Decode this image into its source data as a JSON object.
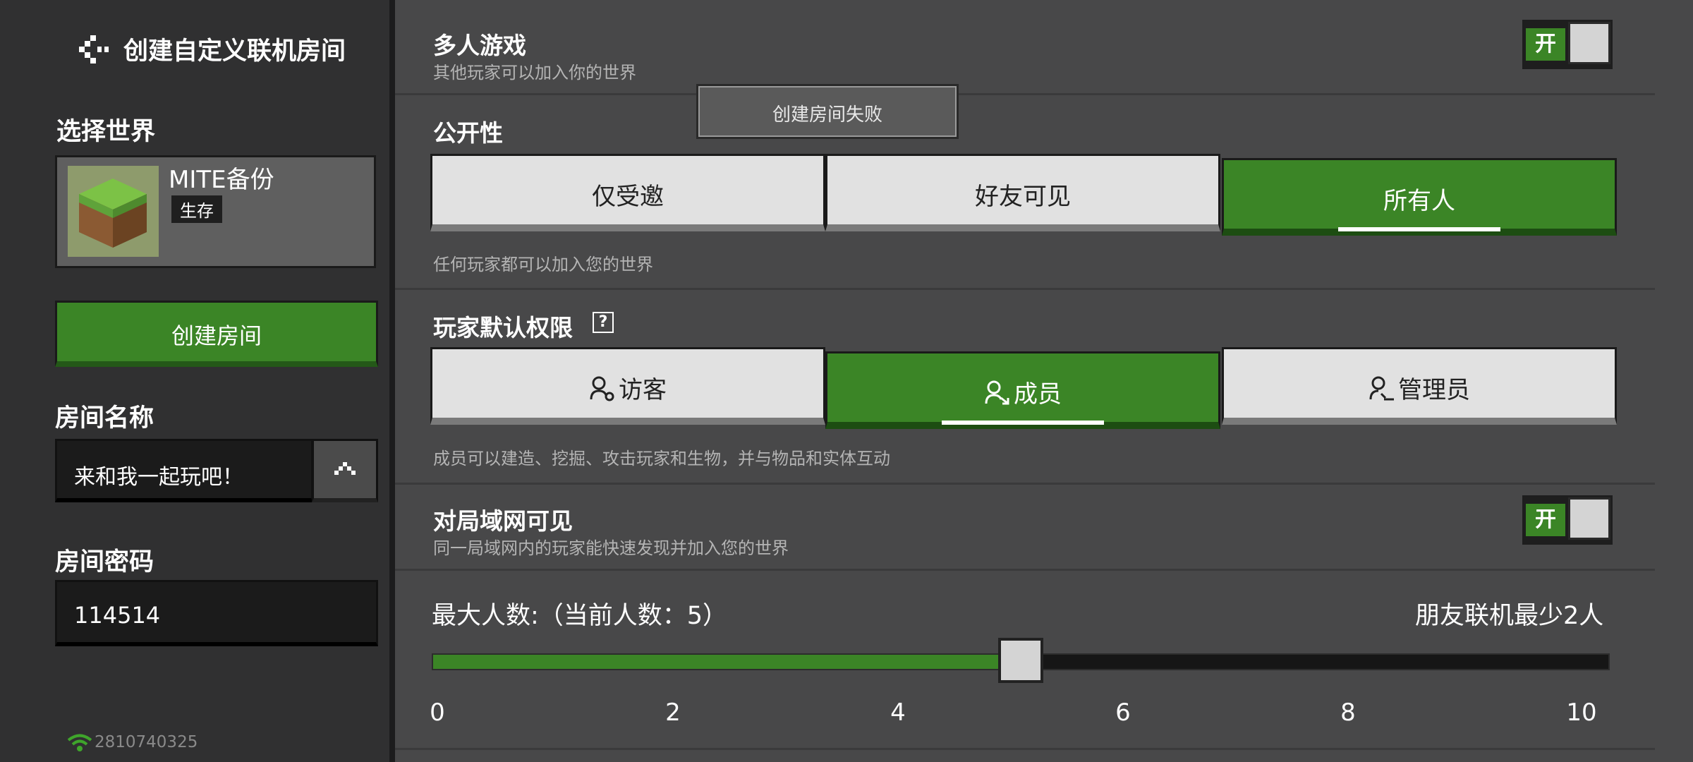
{
  "sidebar": {
    "title": "创建自定义联机房间",
    "select_world_label": "选择世界",
    "world": {
      "name": "MITE备份",
      "mode": "生存"
    },
    "create_button": "创建房间",
    "room_name_label": "房间名称",
    "room_name_value": "来和我一起玩吧！",
    "room_password_label": "房间密码",
    "room_password_value": "114514",
    "device_id": "2810740325"
  },
  "multiplayer": {
    "title": "多人游戏",
    "desc": "其他玩家可以加入你的世界",
    "toggle_label": "开",
    "enabled": true
  },
  "toast": {
    "text": "创建房间失败"
  },
  "visibility": {
    "title": "公开性",
    "options": [
      "仅受邀",
      "好友可见",
      "所有人"
    ],
    "selected": "所有人",
    "desc": "任何玩家都可以加入您的世界"
  },
  "permissions": {
    "title": "玩家默认权限",
    "help_icon": "?",
    "options": [
      "访客",
      "成员",
      "管理员"
    ],
    "selected": "成员",
    "desc": "成员可以建造、挖掘、攻击玩家和生物，并与物品和实体互动"
  },
  "lan": {
    "title": "对局域网可见",
    "desc": "同一局域网内的玩家能快速发现并加入您的世界",
    "toggle_label": "开",
    "enabled": true
  },
  "max_players": {
    "label": "最大人数:（当前人数：5）",
    "note": "朋友联机最少2人",
    "value": 5,
    "min": 0,
    "max": 10,
    "ticks": [
      "0",
      "2",
      "4",
      "6",
      "8",
      "10"
    ]
  },
  "colors": {
    "accent_green": "#3b8526",
    "panel_bg": "#484849",
    "sidebar_bg": "#303031"
  },
  "icons": [
    "back-arrow-icon",
    "world-grass-block-icon",
    "expand-icon",
    "wifi-icon",
    "visitor-icon",
    "member-icon",
    "operator-icon",
    "help-icon"
  ]
}
